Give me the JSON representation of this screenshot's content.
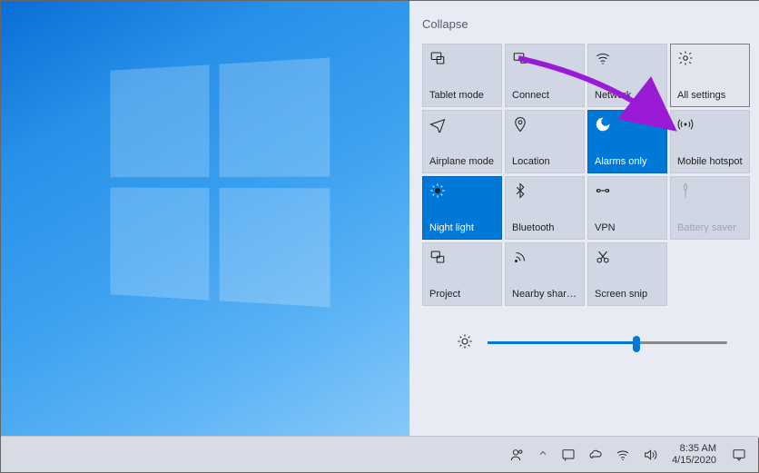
{
  "action_center": {
    "collapse_label": "Collapse",
    "tiles": [
      {
        "id": "tablet-mode",
        "label": "Tablet mode",
        "active": false,
        "disabled": false,
        "highlight": false
      },
      {
        "id": "connect",
        "label": "Connect",
        "active": false,
        "disabled": false,
        "highlight": false
      },
      {
        "id": "network",
        "label": "Network",
        "active": false,
        "disabled": false,
        "highlight": false
      },
      {
        "id": "all-settings",
        "label": "All settings",
        "active": false,
        "disabled": false,
        "highlight": true
      },
      {
        "id": "airplane-mode",
        "label": "Airplane mode",
        "active": false,
        "disabled": false,
        "highlight": false
      },
      {
        "id": "location",
        "label": "Location",
        "active": false,
        "disabled": false,
        "highlight": false
      },
      {
        "id": "alarms-only",
        "label": "Alarms only",
        "active": true,
        "disabled": false,
        "highlight": false
      },
      {
        "id": "mobile-hotspot",
        "label": "Mobile hotspot",
        "active": false,
        "disabled": false,
        "highlight": false
      },
      {
        "id": "night-light",
        "label": "Night light",
        "active": true,
        "disabled": false,
        "highlight": false
      },
      {
        "id": "bluetooth",
        "label": "Bluetooth",
        "active": false,
        "disabled": false,
        "highlight": false
      },
      {
        "id": "vpn",
        "label": "VPN",
        "active": false,
        "disabled": false,
        "highlight": false
      },
      {
        "id": "battery-saver",
        "label": "Battery saver",
        "active": false,
        "disabled": true,
        "highlight": false
      },
      {
        "id": "project",
        "label": "Project",
        "active": false,
        "disabled": false,
        "highlight": false
      },
      {
        "id": "nearby-sharing",
        "label": "Nearby sharing",
        "active": false,
        "disabled": false,
        "highlight": false
      },
      {
        "id": "screen-snip",
        "label": "Screen snip",
        "active": false,
        "disabled": false,
        "highlight": false
      }
    ],
    "brightness_percent": 62
  },
  "taskbar": {
    "time": "8:35 AM",
    "date": "4/15/2020"
  },
  "annotation": {
    "arrow_color": "#9a1bd6",
    "arrow_target": "all-settings"
  }
}
